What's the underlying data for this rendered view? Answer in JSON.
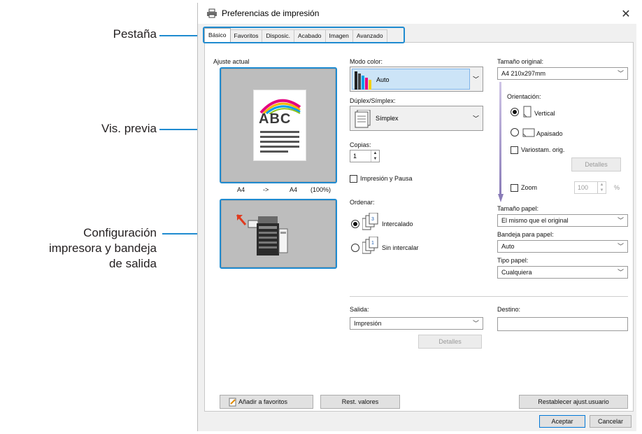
{
  "annotations": {
    "tab_label": "Pestaña",
    "preview_label": "Vis. previa",
    "printer_label_line1": "Configuración",
    "printer_label_line2": "impresora y bandeja",
    "printer_label_line3": "de salida",
    "accent_color": "#1f8bd0"
  },
  "window": {
    "title": "Preferencias de impresión",
    "close_icon": "close-icon"
  },
  "tabs": [
    "Básico",
    "Favoritos",
    "Disposic.",
    "Acabado",
    "Imagen",
    "Avanzado"
  ],
  "left": {
    "ajuste_label": "Ajuste actual",
    "preview_text": "ABC",
    "size_from": "A4",
    "arrow": "->",
    "size_to": "A4",
    "percent": "(100%)"
  },
  "middle": {
    "modo_color_label": "Modo color:",
    "modo_color_value": "Auto",
    "duplex_label": "Dúplex/Símplex:",
    "duplex_value": "Símplex",
    "copias_label": "Copias:",
    "copias_value": "1",
    "pausa_label": "Impresión y Pausa",
    "ordenar_label": "Ordenar:",
    "intercalado_label": "Intercalado",
    "sin_intercalar_label": "Sin intercalar"
  },
  "right": {
    "tamano_original_label": "Tamaño original:",
    "tamano_original_value": "A4 210x297mm",
    "orientacion_label": "Orientación:",
    "vertical_label": "Vertical",
    "apaisado_label": "Apaisado",
    "variostam_label": "Variostam. orig.",
    "detalles_label": "Detalles",
    "zoom_label": "Zoom",
    "zoom_value": "100",
    "zoom_unit": "%",
    "tamano_papel_label": "Tamaño papel:",
    "tamano_papel_value": "El mismo que el original",
    "bandeja_label": "Bandeja para papel:",
    "bandeja_value": "Auto",
    "tipo_label": "Tipo papel:",
    "tipo_value": "Cualquiera"
  },
  "bottom": {
    "salida_label": "Salida:",
    "salida_value": "Impresión",
    "detalles_label": "Detalles",
    "destino_label": "Destino:",
    "destino_value": ""
  },
  "footer": {
    "anadir_label": "Añadir a favoritos",
    "rest_label": "Rest. valores",
    "restablecer_label": "Restablecer ajust.usuario",
    "aceptar_label": "Aceptar",
    "cancelar_label": "Cancelar"
  }
}
